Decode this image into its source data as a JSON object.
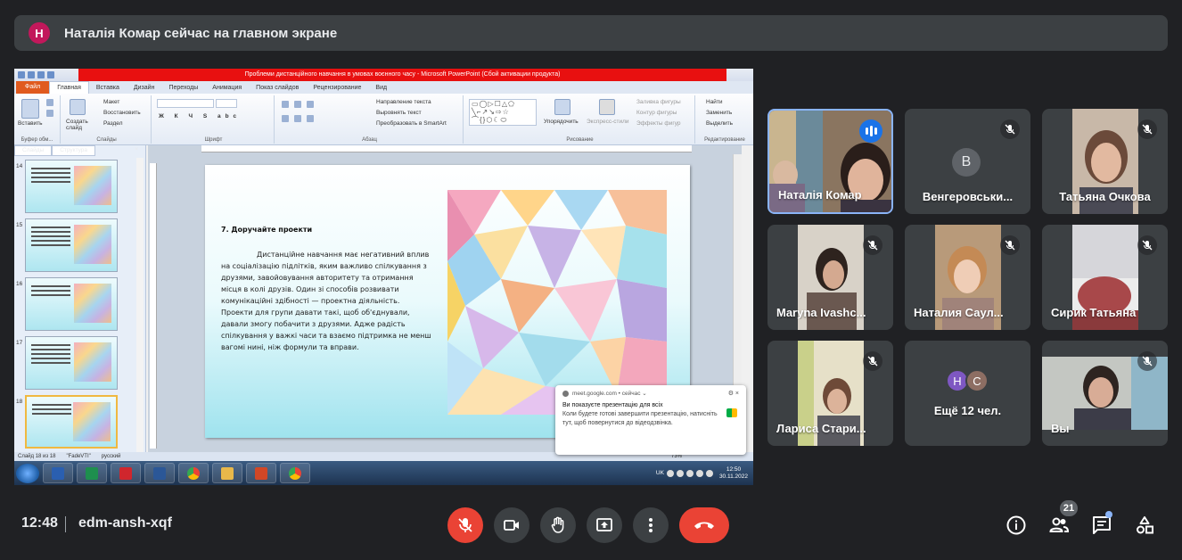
{
  "banner": {
    "avatar_letter": "Н",
    "text": "Наталія Комар сейчас на главном экране"
  },
  "shared_screen": {
    "window_title": "Проблеми дистанційного навчання в умовах воєнного часу - Microsoft PowerPoint (Сбой активации продукта)",
    "tabs": [
      "Файл",
      "Главная",
      "Вставка",
      "Дизайн",
      "Переходы",
      "Анимация",
      "Показ слайдов",
      "Рецензирование",
      "Вид"
    ],
    "ribbon": {
      "paste": "Вставить",
      "clipboard_group": "Буфер обм...",
      "create_slide": "Создать слайд",
      "layout": "Макет",
      "restore": "Восстановить",
      "section": "Раздел",
      "slides_group": "Слайды",
      "font_group": "Шрифт",
      "paragraph_group": "Абзац",
      "text_direction": "Направление текста",
      "align_text": "Выровнять текст",
      "smartart": "Преобразовать в SmartArt",
      "arrange": "Упорядочить",
      "quick_styles": "Экспресс-стили",
      "shape_fill": "Заливка фигуры",
      "shape_outline": "Контур фигуры",
      "shape_effects": "Эффекты фигур",
      "drawing_group": "Рисование",
      "find": "Найти",
      "replace": "Заменить",
      "select": "Выделить",
      "editing_group": "Редактирование"
    },
    "panel_tabs": [
      "Слайды",
      "Структура"
    ],
    "thumbnails": [
      "14",
      "15",
      "16",
      "17",
      "18"
    ],
    "slide": {
      "heading": "7. Доручайте проекти",
      "body": "Дистанційне навчання має негативний вплив на соціалізацію підлітків, яким важливо спілкування з друзями, завойовування авторитету та отримання місця в колі друзів. Один зі способів розвивати комунікаційні здібності — проектна діяльність. Проекти для групи давати такі, щоб об'єднували, давали змогу побачити з друзями. Адже радість спілкування у важкі часи та взаємо підтримка не менш вагомі нині, ніж формули та вправи."
    },
    "status": {
      "slide_counter": "Слайд 18 из 18",
      "theme": "\"FadeVTI\"",
      "language": "русский",
      "zoom": "73%"
    },
    "tray": {
      "lang": "UK",
      "time": "12:50",
      "date": "30.11.2022"
    },
    "toast": {
      "source": "meet.google.com • сейчас ⌄",
      "title": "Ви показуєте презентацію для всіх",
      "body": "Коли будете готові завершити презентацію, натисніть тут, щоб повернутися до відеодзвінка."
    }
  },
  "participants": [
    {
      "name": "Наталія Комар",
      "state": "speaking"
    },
    {
      "name": "Венгеровськи...",
      "state": "muted",
      "avatar_letter": "В"
    },
    {
      "name": "Татьяна Очкова",
      "state": "muted"
    },
    {
      "name": "Maryna Ivashc...",
      "state": "muted"
    },
    {
      "name": "Наталия Саул...",
      "state": "muted"
    },
    {
      "name": "Сирик Татьяна",
      "state": "muted"
    },
    {
      "name": "Лариса Стари...",
      "state": "muted"
    },
    {
      "name": "Ещё 12 чел.",
      "state": "overflow",
      "avatars": [
        "Н",
        "С"
      ]
    },
    {
      "name": "Вы",
      "state": "muted"
    }
  ],
  "bottom_bar": {
    "time": "12:48",
    "meeting_code": "edm-ansh-xqf",
    "people_count": "21"
  },
  "colors": {
    "background": "#202124",
    "tile": "#3c4043",
    "danger": "#ea4335",
    "accent": "#8ab4f8",
    "speaking": "#1a73e8"
  }
}
